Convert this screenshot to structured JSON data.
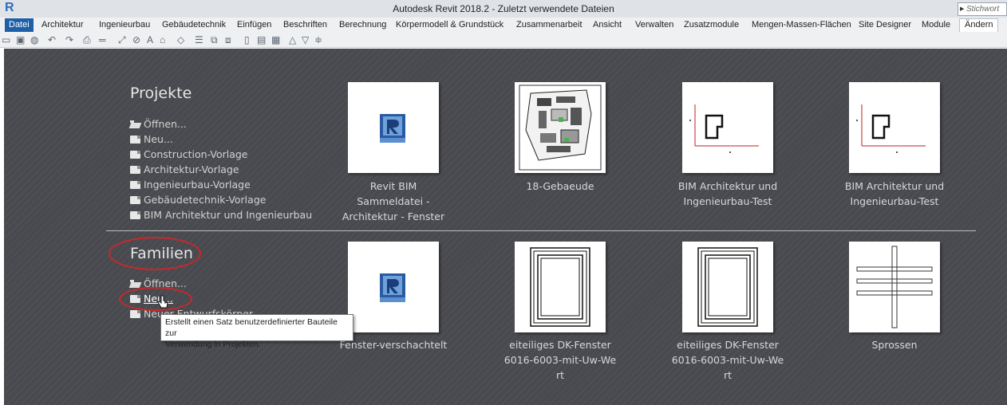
{
  "window": {
    "title": "Autodesk Revit 2018.2 -   Zuletzt verwendete Dateien",
    "search_placeholder": "Stichwort"
  },
  "ribbon": {
    "tabs": [
      {
        "label": "Datei"
      },
      {
        "label": "Architektur"
      },
      {
        "label": "Ingenieurbau"
      },
      {
        "label": "Gebäudetechnik"
      },
      {
        "label": "Einfügen"
      },
      {
        "label": "Beschriften"
      },
      {
        "label": "Berechnung"
      },
      {
        "label": "Körpermodell & Grundstück"
      },
      {
        "label": "Zusammenarbeit"
      },
      {
        "label": "Ansicht"
      },
      {
        "label": "Verwalten"
      },
      {
        "label": "Zusatzmodule"
      },
      {
        "label": "Mengen-Massen-Flächen"
      },
      {
        "label": "Site Designer"
      },
      {
        "label": "Module"
      },
      {
        "label": "Ändern"
      }
    ]
  },
  "projects": {
    "heading": "Projekte",
    "links": [
      {
        "label": "Öffnen...",
        "icon": "folder-open-icon"
      },
      {
        "label": "Neu...",
        "icon": "document-icon"
      },
      {
        "label": "Construction-Vorlage",
        "icon": "document-icon"
      },
      {
        "label": "Architektur-Vorlage",
        "icon": "document-icon"
      },
      {
        "label": "Ingenieurbau-Vorlage",
        "icon": "document-icon"
      },
      {
        "label": "Gebäudetechnik-Vorlage",
        "icon": "document-icon"
      },
      {
        "label": "BIM Architektur und Ingenieurbau",
        "icon": "document-icon"
      }
    ],
    "recent": [
      {
        "line1": "Revit BIM",
        "line2": "Sammeldatei -",
        "line3": "Architektur - Fenster",
        "thumbnail": "revit-logo-icon"
      },
      {
        "line1": "18-Gebaeude",
        "thumbnail": "site-plan-preview"
      },
      {
        "line1": "BIM Architektur und",
        "line2": "Ingenieurbau-Test",
        "thumbnail": "floor-plan-preview"
      },
      {
        "line1": "BIM Architektur und",
        "line2": "Ingenieurbau-Test",
        "thumbnail": "floor-plan-preview"
      }
    ]
  },
  "families": {
    "heading": "Familien",
    "links": [
      {
        "label": "Öffnen...",
        "icon": "folder-open-icon"
      },
      {
        "label": "Neu...",
        "icon": "document-icon"
      },
      {
        "label": "Neuer Entwurfskörper...",
        "icon": "document-icon"
      }
    ],
    "recent": [
      {
        "line1": "Fenster-verschachtelt",
        "thumbnail": "revit-logo-icon"
      },
      {
        "line1": "eiteiliges DK-Fenster",
        "line2": "6016-6003-mit-Uw-We",
        "line3": "rt",
        "thumbnail": "window-preview"
      },
      {
        "line1": "eiteiliges DK-Fenster",
        "line2": "6016-6003-mit-Uw-We",
        "line3": "rt",
        "thumbnail": "window-preview"
      },
      {
        "line1": "Sprossen",
        "thumbnail": "mullion-preview"
      }
    ]
  },
  "tooltip": {
    "line1": "Erstellt einen Satz benutzerdefinierter Bauteile zur",
    "line2": "Verwendung in Projekten."
  },
  "colors": {
    "accent": "#1f5fa8",
    "highlight": "#c9282a",
    "background": "#494a4f"
  }
}
